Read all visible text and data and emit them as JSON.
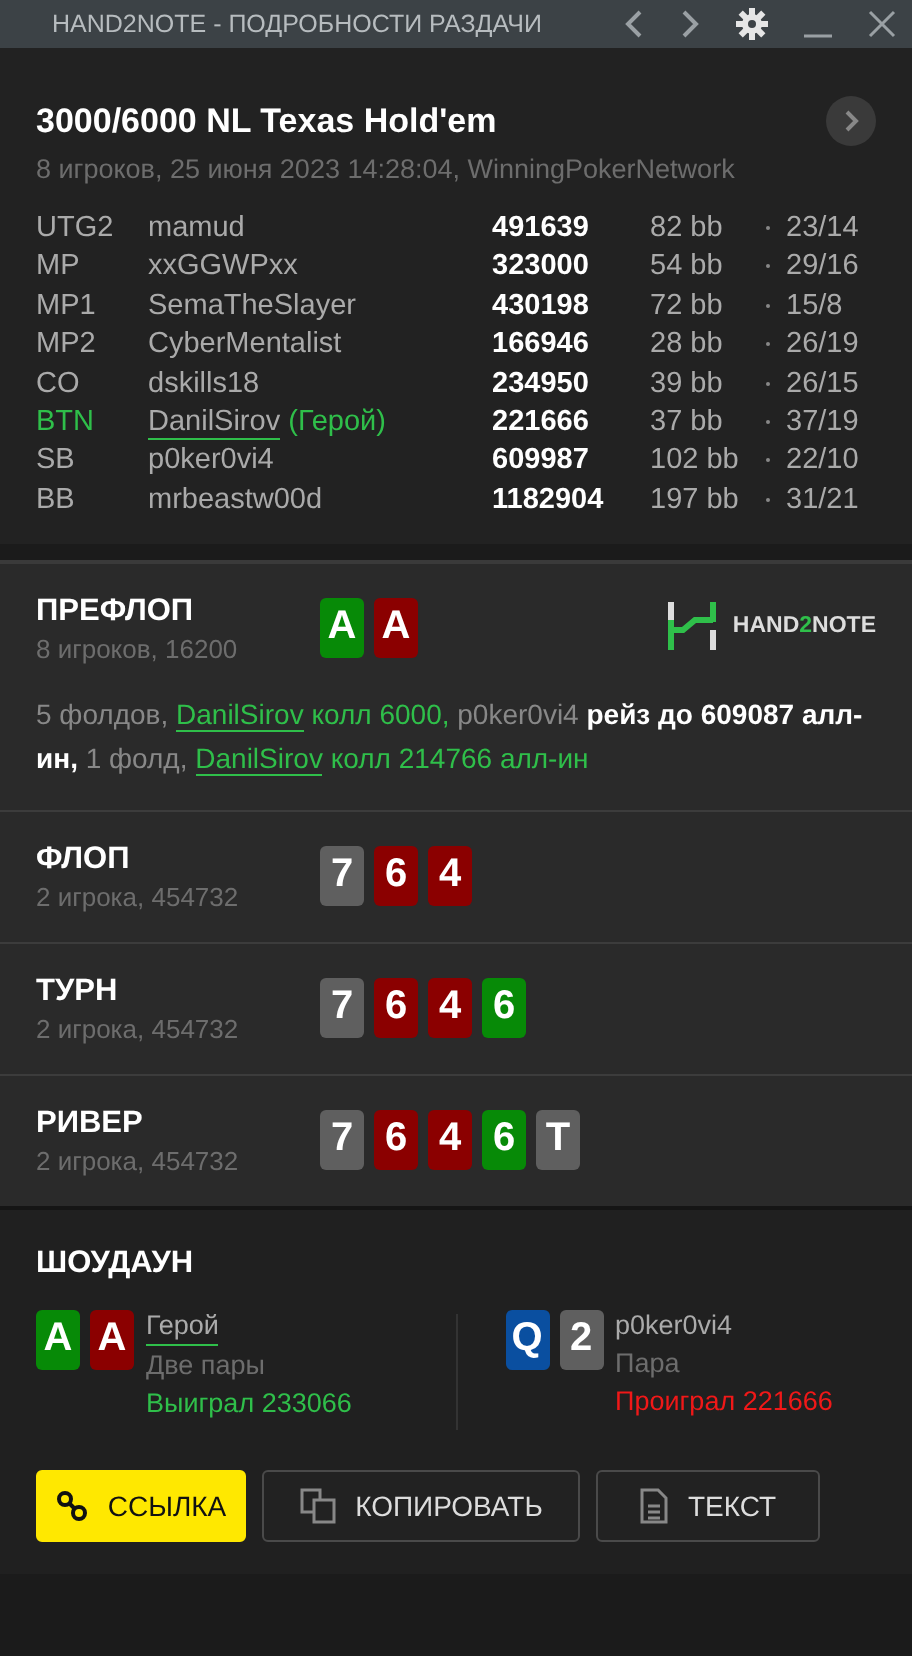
{
  "window": {
    "title": "HAND2NOTE - ПОДРОБНОСТИ РАЗДАЧИ"
  },
  "hand": {
    "title": "3000/6000 NL Texas Hold'em",
    "subtitle": "8 игроков, 25 июня 2023 14:28:04, WinningPokerNetwork"
  },
  "players": [
    {
      "position": "UTG2",
      "name": "mamud",
      "stack": "491639",
      "bb": "82 bb",
      "stats": "23/14",
      "hero": false
    },
    {
      "position": "MP",
      "name": "xxGGWPxx",
      "stack": "323000",
      "bb": "54 bb",
      "stats": "29/16",
      "hero": false
    },
    {
      "position": "MP1",
      "name": "SemaTheSlayer",
      "stack": "430198",
      "bb": "72 bb",
      "stats": "15/8",
      "hero": false
    },
    {
      "position": "MP2",
      "name": "CyberMentalist",
      "stack": "166946",
      "bb": "28 bb",
      "stats": "26/19",
      "hero": false
    },
    {
      "position": "CO",
      "name": "dskills18",
      "stack": "234950",
      "bb": "39 bb",
      "stats": "26/15",
      "hero": false
    },
    {
      "position": "BTN",
      "name": "DanilSirov",
      "note": "(Герой)",
      "stack": "221666",
      "bb": "37 bb",
      "stats": "37/19",
      "hero": true
    },
    {
      "position": "SB",
      "name": "p0ker0vi4",
      "stack": "609987",
      "bb": "102 bb",
      "stats": "22/10",
      "hero": false
    },
    {
      "position": "BB",
      "name": "mrbeastw00d",
      "stack": "1182904",
      "bb": "197 bb",
      "stats": "31/21",
      "hero": false
    }
  ],
  "logo": {
    "prefix": "HAND",
    "accent": "2",
    "suffix": "NOTE"
  },
  "streets": [
    {
      "name": "ПРЕФЛОП",
      "info": "8 игроков, 16200",
      "cards": [
        {
          "rank": "A",
          "color": "#078a07"
        },
        {
          "rank": "A",
          "color": "#8b0000"
        }
      ],
      "actions": [
        {
          "kind": "plain",
          "text": "5 фолдов, "
        },
        {
          "kind": "hero-link",
          "text": "DanilSirov"
        },
        {
          "kind": "hero",
          "text": " колл 6000,"
        },
        {
          "kind": "plain",
          "text": " p0ker0vi4 "
        },
        {
          "kind": "bold",
          "text": "рейз до 609087 алл-ин,"
        },
        {
          "kind": "plain",
          "text": " 1 фолд, "
        },
        {
          "kind": "hero-link",
          "text": "DanilSirov"
        },
        {
          "kind": "hero",
          "text": " колл 214766 алл-ин"
        }
      ]
    },
    {
      "name": "ФЛОП",
      "info": "2 игрока, 454732",
      "cards": [
        {
          "rank": "7",
          "color": "#5f5f5f"
        },
        {
          "rank": "6",
          "color": "#8b0000"
        },
        {
          "rank": "4",
          "color": "#8b0000"
        }
      ]
    },
    {
      "name": "ТУРН",
      "info": "2 игрока, 454732",
      "cards": [
        {
          "rank": "7",
          "color": "#5f5f5f"
        },
        {
          "rank": "6",
          "color": "#8b0000"
        },
        {
          "rank": "4",
          "color": "#8b0000"
        },
        {
          "rank": "6",
          "color": "#078a07"
        }
      ]
    },
    {
      "name": "РИВЕР",
      "info": "2 игрока, 454732",
      "cards": [
        {
          "rank": "7",
          "color": "#5f5f5f"
        },
        {
          "rank": "6",
          "color": "#8b0000"
        },
        {
          "rank": "4",
          "color": "#8b0000"
        },
        {
          "rank": "6",
          "color": "#078a07"
        },
        {
          "rank": "T",
          "color": "#5f5f5f"
        }
      ]
    }
  ],
  "showdown": {
    "title": "ШОУДАУН",
    "hands": [
      {
        "cards": [
          {
            "rank": "A",
            "color": "#078a07"
          },
          {
            "rank": "A",
            "color": "#8b0000"
          }
        ],
        "name": "Герой",
        "hero": true,
        "combo": "Две пары",
        "result": "Выиграл 233066",
        "won": true
      },
      {
        "cards": [
          {
            "rank": "Q",
            "color": "#0a4fa0"
          },
          {
            "rank": "2",
            "color": "#5f5f5f"
          }
        ],
        "name": "p0ker0vi4",
        "hero": false,
        "combo": "Пара",
        "result": "Проиграл 221666",
        "won": false
      }
    ]
  },
  "buttons": [
    {
      "label": "ССЫЛКА",
      "kind": "link",
      "primary": true
    },
    {
      "label": "КОПИРОВАТЬ",
      "kind": "copy",
      "primary": false
    },
    {
      "label": "ТЕКСТ",
      "kind": "text",
      "primary": false
    }
  ]
}
